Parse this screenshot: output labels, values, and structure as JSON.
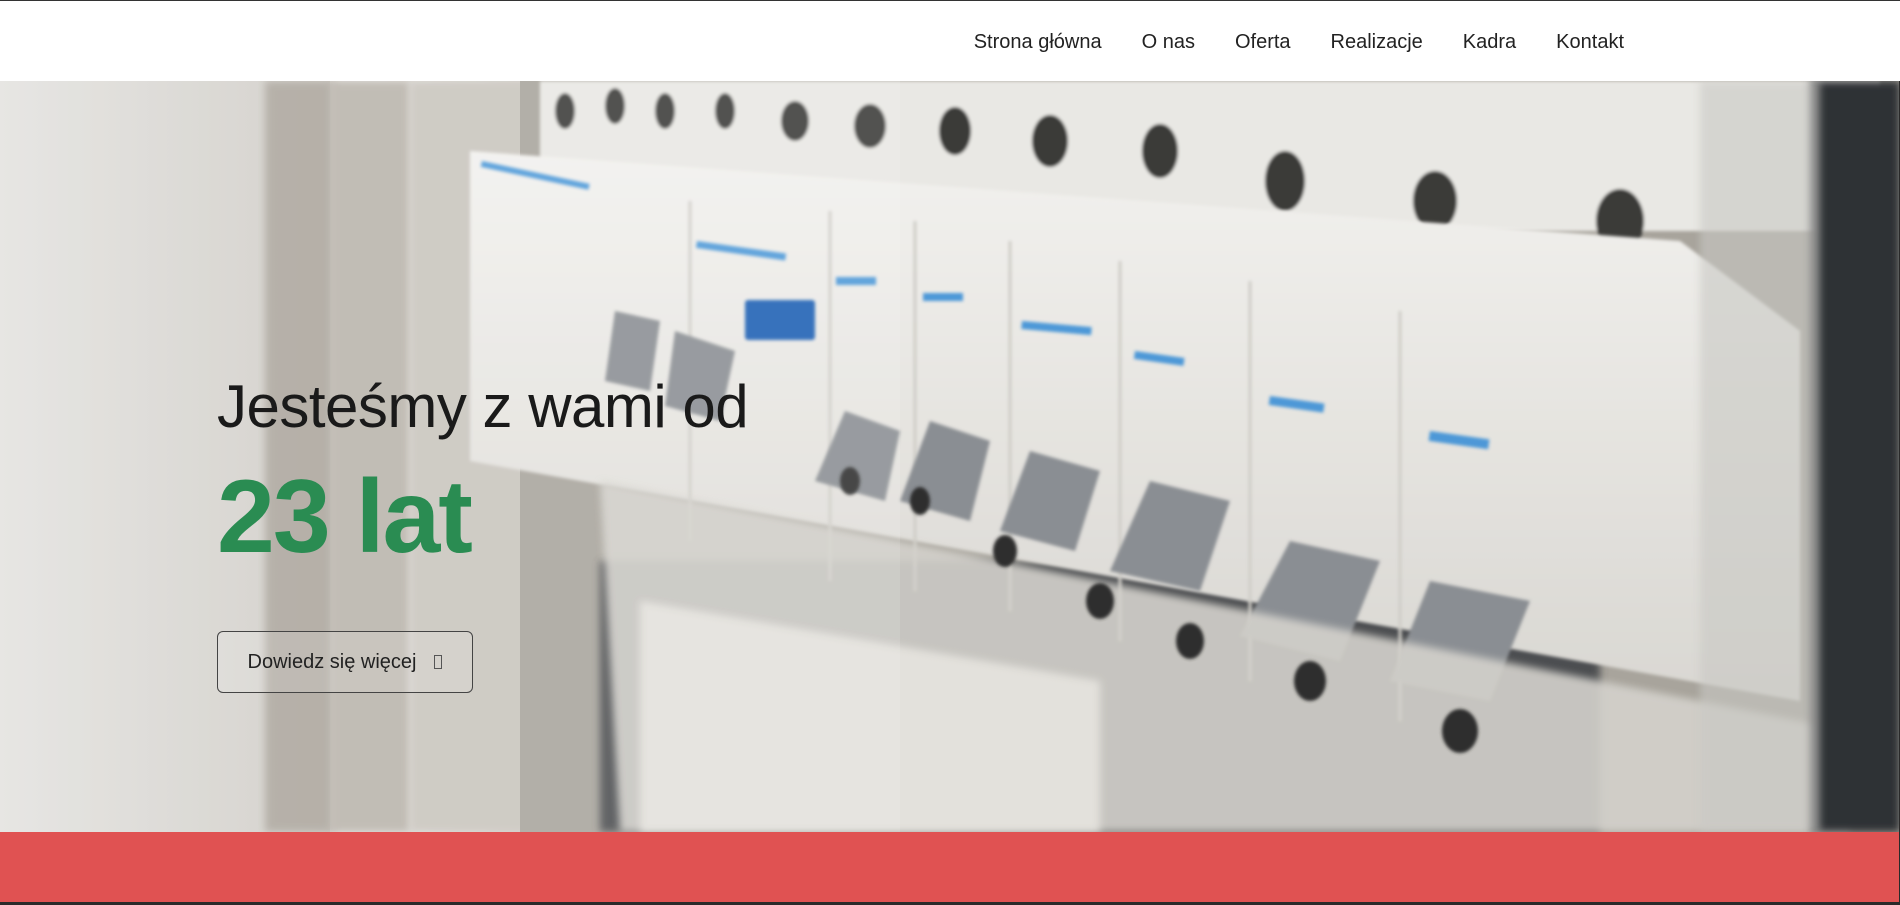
{
  "nav": {
    "items": [
      "Strona główna",
      "O nas",
      "Oferta",
      "Realizacje",
      "Kadra",
      "Kontakt"
    ]
  },
  "hero": {
    "subtitle": "Jesteśmy z wami od",
    "headline": "23 lat",
    "button_label": "Dowiedz się więcej",
    "button_icon": "square-outline-icon",
    "background_image": "electrical-circuit-breaker-panel"
  },
  "colors": {
    "accent_green": "#2a8c52",
    "red_bar": "#e05252",
    "header_bg": "#ffffff"
  }
}
